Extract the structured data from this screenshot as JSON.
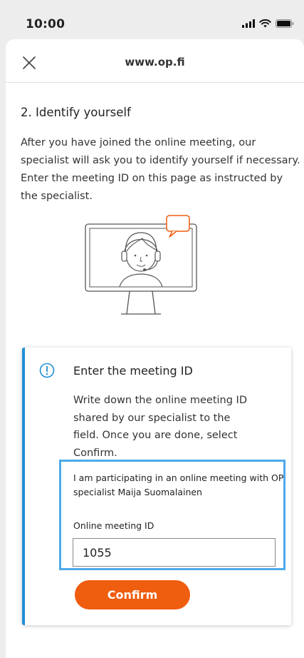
{
  "status_bar": {
    "time": "10:00",
    "icons": [
      "signal-icon",
      "wifi-icon",
      "battery-icon"
    ]
  },
  "browser": {
    "url": "www.op.fi",
    "close_icon": "close-icon"
  },
  "step": {
    "title": "2. Identify yourself",
    "description": "After you have joined the online meeting, our specialist will ask you to identify yourself if necessary. Enter the meeting ID on this page as instructed by the specialist."
  },
  "illustration": {
    "icon": "specialist-monitor-icon"
  },
  "card": {
    "icon": "info-icon",
    "title": "Enter the meeting ID",
    "text": "Write down the online meeting ID shared by our specialist to the field. Once you are done, select Confirm.",
    "meeting_note": "I am participating in an online meeting with OP specialist Maija Suomalainen",
    "field_label": "Online meeting ID",
    "field_value": "1055",
    "confirm_label": "Confirm"
  },
  "colors": {
    "accent_orange": "#ef5d0f",
    "info_blue": "#1f8fd6",
    "highlight_blue": "#4da9ea"
  }
}
